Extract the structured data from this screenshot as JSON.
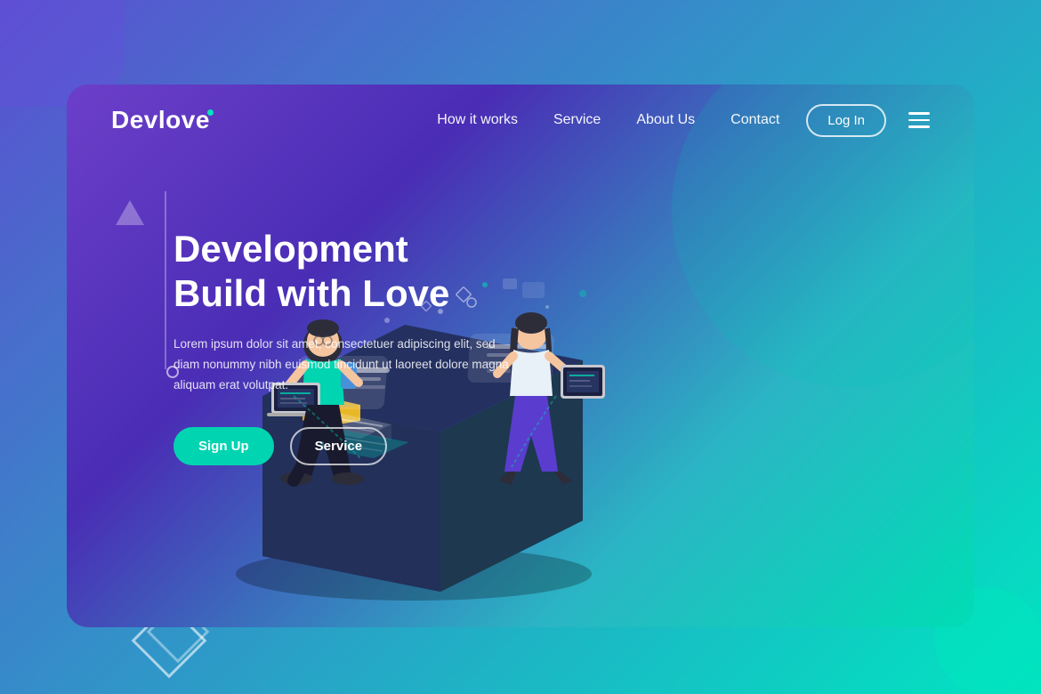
{
  "meta": {
    "title": "Devlove - Development Build with Love"
  },
  "logo": {
    "name": "Devlove",
    "dot": "•"
  },
  "nav": {
    "links": [
      {
        "id": "how-it-works",
        "label": "How it works"
      },
      {
        "id": "service",
        "label": "Service"
      },
      {
        "id": "about-us",
        "label": "About Us"
      },
      {
        "id": "contact",
        "label": "Contact"
      }
    ],
    "login_label": "Log In",
    "menu_icon": "≡"
  },
  "hero": {
    "title_line1": "Development",
    "title_line2": "Build with Love",
    "description": "Lorem ipsum dolor sit amet, consectetuer adipiscing elit, sed diam nonummy nibh euismod tincidunt ut laoreet dolore magna aliquam erat volutpat.",
    "btn_signup": "Sign Up",
    "btn_service": "Service"
  },
  "colors": {
    "accent_teal": "#00d4b0",
    "bg_gradient_start": "#6c3fc9",
    "bg_gradient_end": "#00ddb5",
    "outer_bg_start": "#5b4fcf",
    "outer_bg_end": "#00e5c0"
  }
}
